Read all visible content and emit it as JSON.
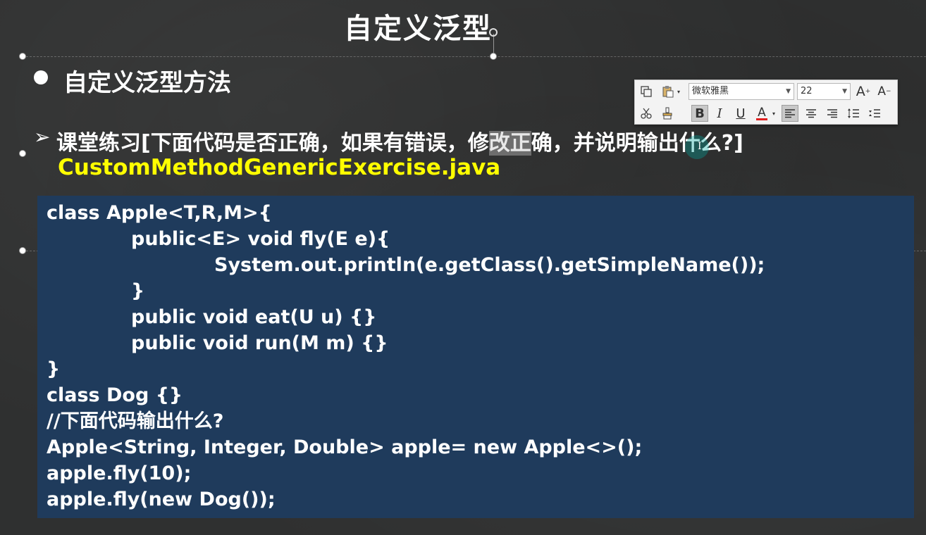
{
  "slide": {
    "title": "自定义泛型",
    "heading": "自定义泛型方法",
    "exercise_prefix": "课堂练习[下面代码是否正确，如果有错误，修",
    "exercise_highlight": "改正",
    "exercise_suffix": "确，并说明输出什么?]",
    "filename": "CustomMethodGenericExercise.java",
    "arrow_glyph": "➢"
  },
  "code": {
    "lines": [
      "class Apple<T,R,M>{",
      "public<E> void fly(E e){",
      "System.out.println(e.getClass().getSimpleName());",
      "}",
      "public void eat(U u) {}",
      "public void run(M m) {}",
      "}",
      "class Dog {}",
      "//下面代码输出什么?",
      "Apple<String, Integer, Double> apple= new Apple<>();",
      "apple.fly(10);",
      "apple.fly(new Dog());"
    ]
  },
  "toolbar": {
    "font_name": "微软雅黑",
    "font_size": "22",
    "grow_font_label": "A",
    "shrink_font_label": "A",
    "bold_label": "B",
    "italic_label": "I",
    "underline_label": "U",
    "font_color_label": "A",
    "font_color": "#e02020",
    "icons": [
      "copy-icon",
      "paste-icon",
      "cut-icon",
      "format-painter-icon",
      "align-left-icon",
      "align-center-icon",
      "align-right-icon",
      "line-spacing-icon",
      "paragraph-spacing-icon"
    ]
  },
  "colors": {
    "code_bg": "#1f3b5c",
    "filename": "#ffff00",
    "background": "#2f3030"
  }
}
